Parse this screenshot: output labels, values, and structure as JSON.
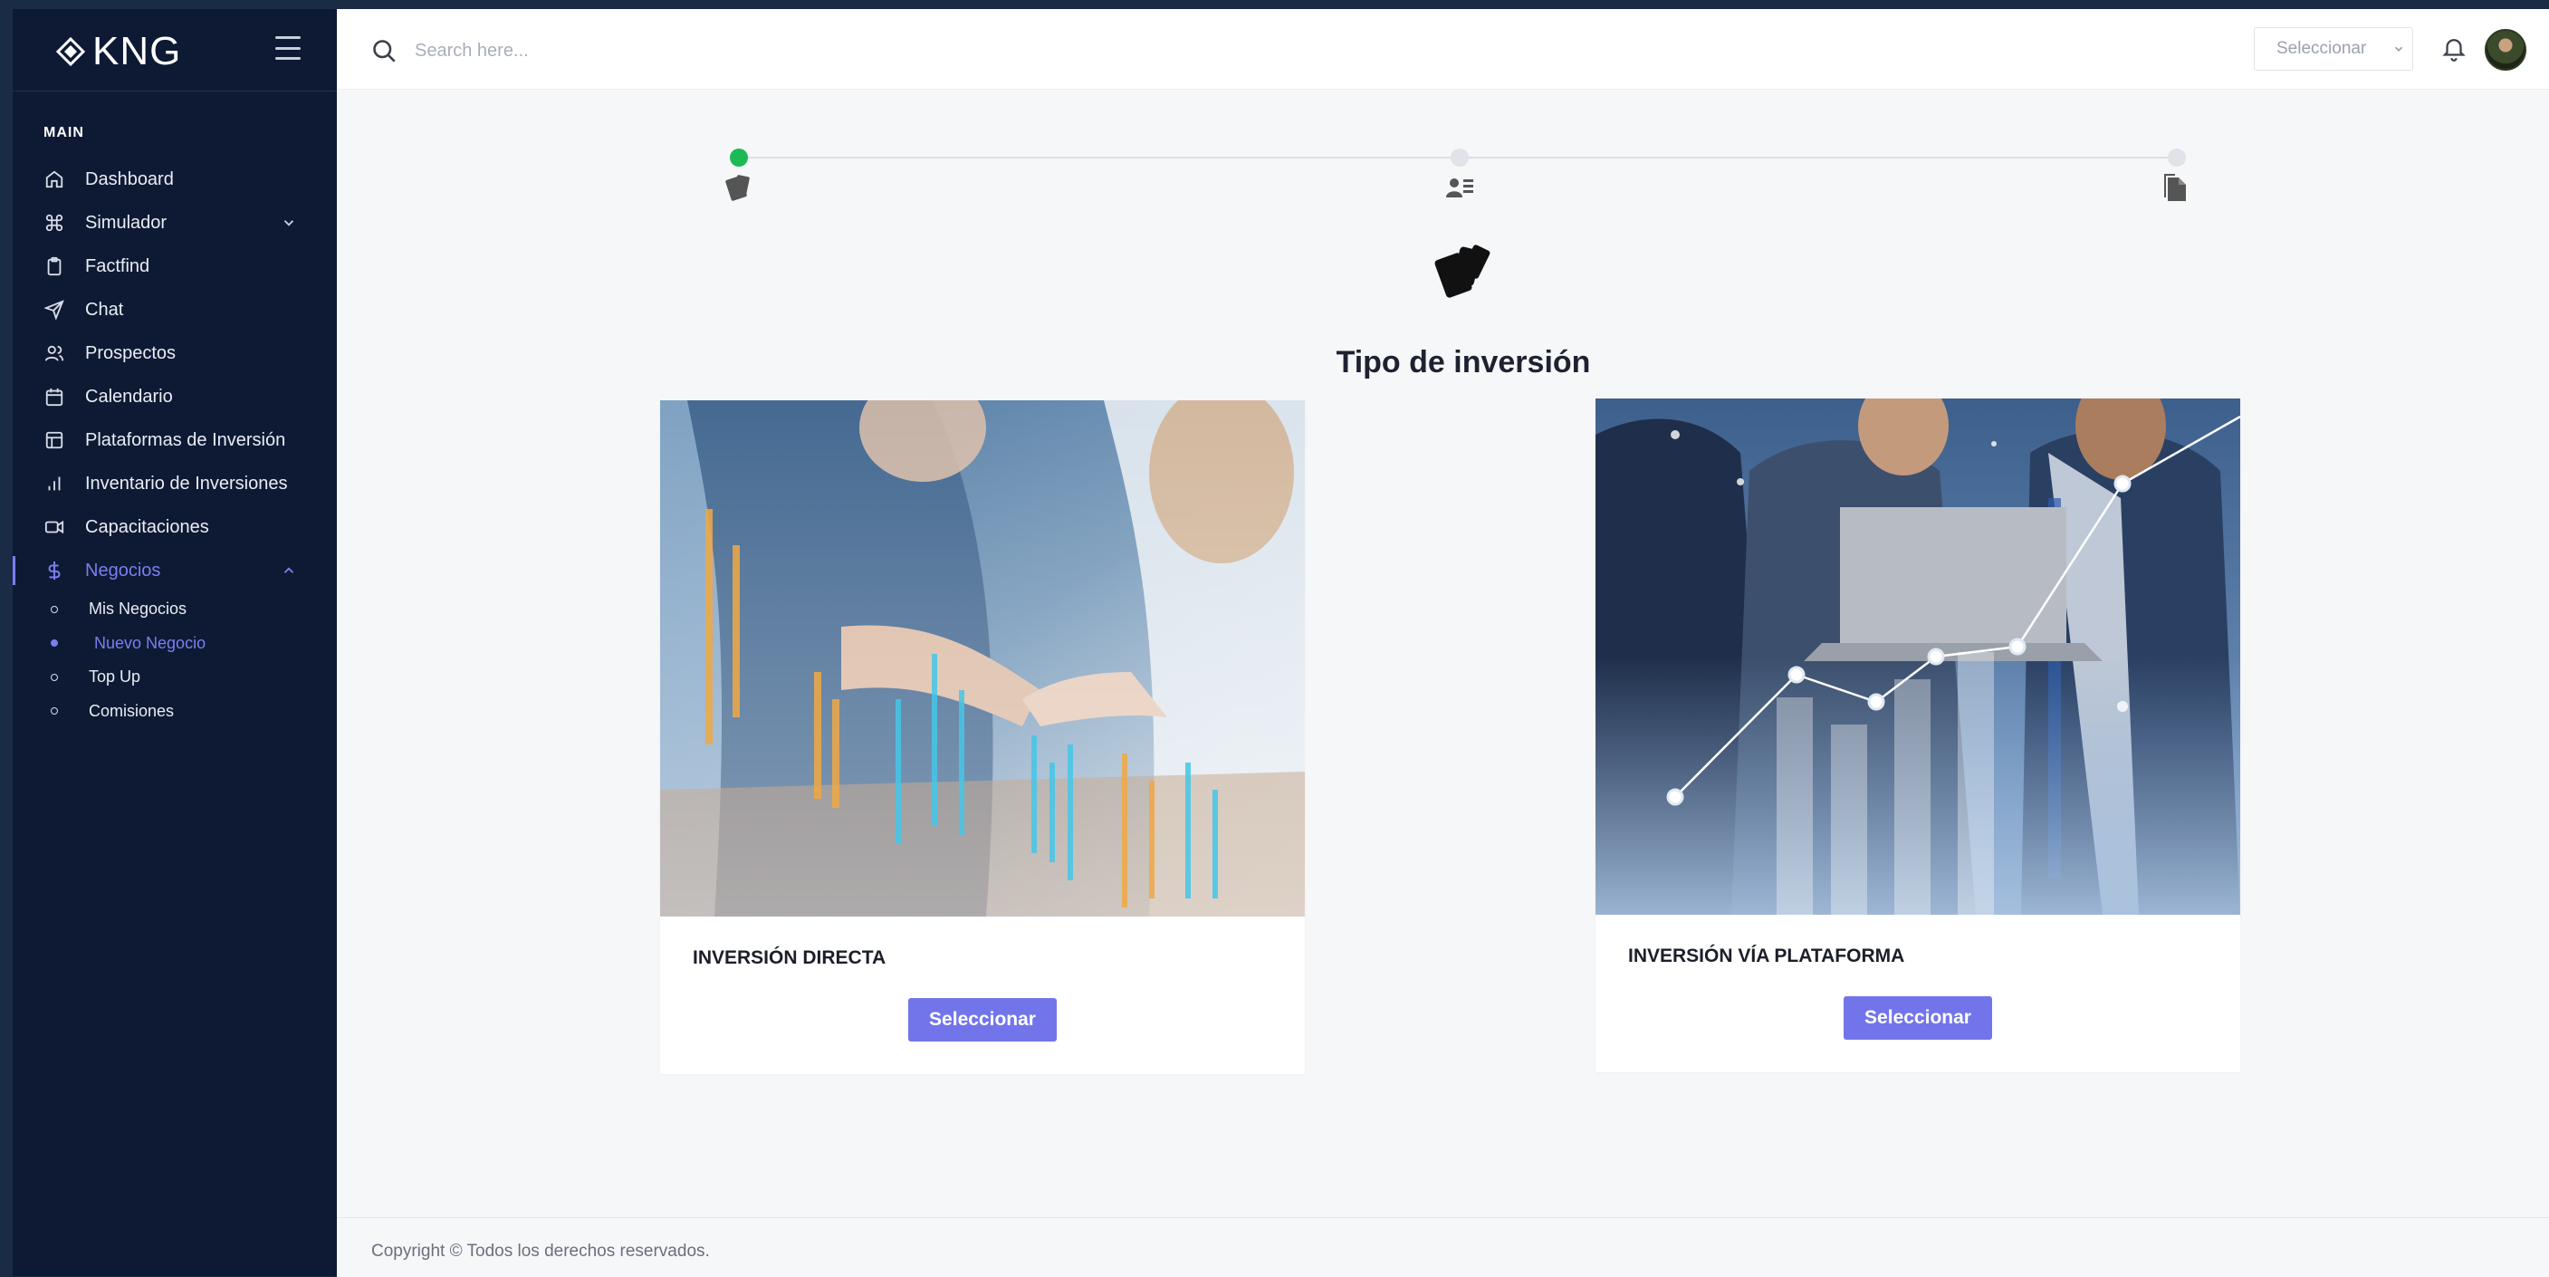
{
  "brand": {
    "name": "KNG"
  },
  "sidebar": {
    "section_title": "MAIN",
    "items": [
      {
        "label": "Dashboard",
        "icon": "home-icon"
      },
      {
        "label": "Simulador",
        "icon": "command-icon",
        "expandable": true
      },
      {
        "label": "Factfind",
        "icon": "clipboard-icon"
      },
      {
        "label": "Chat",
        "icon": "send-icon"
      },
      {
        "label": "Prospectos",
        "icon": "users-icon"
      },
      {
        "label": "Calendario",
        "icon": "calendar-icon"
      },
      {
        "label": "Plataformas de Inversión",
        "icon": "layout-icon"
      },
      {
        "label": "Inventario de Inversiones",
        "icon": "bar-chart-icon"
      },
      {
        "label": "Capacitaciones",
        "icon": "video-icon"
      },
      {
        "label": "Negocios",
        "icon": "dollar-icon",
        "expanded": true,
        "active": true
      }
    ],
    "subitems": [
      {
        "label": "Mis Negocios"
      },
      {
        "label": "Nuevo Negocio",
        "active": true
      },
      {
        "label": "Top Up"
      },
      {
        "label": "Comisiones"
      }
    ]
  },
  "topbar": {
    "search_placeholder": "Search here...",
    "select_value": "Seleccionar"
  },
  "stepper": {
    "steps": [
      {
        "icon": "cards-icon",
        "status": "done"
      },
      {
        "icon": "user-list-icon",
        "status": "pending"
      },
      {
        "icon": "document-icon",
        "status": "pending"
      }
    ]
  },
  "main": {
    "heading": "Tipo de inversión",
    "cards": [
      {
        "title": "INVERSIÓN DIRECTA",
        "button": "Seleccionar",
        "image": "handshake-photo"
      },
      {
        "title": "INVERSIÓN VÍA PLATAFORMA",
        "button": "Seleccionar",
        "image": "business-team-laptop-photo"
      }
    ]
  },
  "footer": {
    "text": "Copyright © Todos los derechos reservados."
  },
  "colors": {
    "accent": "#7275ea",
    "sidebar_bg": "#0e1a34",
    "success": "#1db954"
  }
}
